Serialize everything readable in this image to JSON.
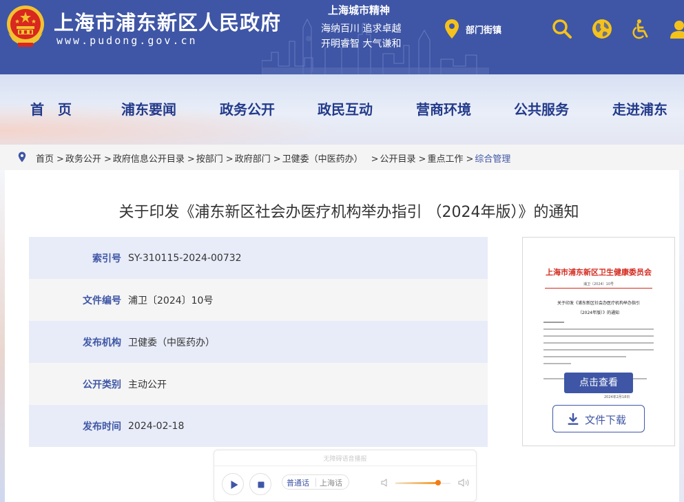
{
  "header": {
    "site_title": "上海市浦东新区人民政府",
    "site_url": "www.pudong.gov.cn",
    "spirit": {
      "title": "上海城市精神",
      "line1": "海纳百川   追求卓越",
      "line2": "开明睿智   大气谦和"
    },
    "department_link": "部门街镇",
    "icons": [
      "location-pin-icon",
      "search-icon",
      "globe-icon",
      "accessibility-icon",
      "user-icon"
    ]
  },
  "nav": {
    "items": [
      "首　页",
      "浦东要闻",
      "政务公开",
      "政民互动",
      "营商环境",
      "公共服务",
      "走进浦东"
    ]
  },
  "breadcrumb": {
    "items": [
      "首页",
      "政务公开",
      "政府信息公开目录",
      "按部门",
      "政府部门",
      "卫健委（中医药办）",
      "公开目录",
      "重点工作",
      "综合管理"
    ],
    "separator": ">"
  },
  "article": {
    "title": "关于印发《浦东新区社会办医疗机构举办指引 （2024年版）》的通知",
    "meta": [
      {
        "label": "索引号",
        "value": "SY-310115-2024-00732"
      },
      {
        "label": "文件编号",
        "value": "浦卫〔2024〕10号"
      },
      {
        "label": "发布机构",
        "value": "卫健委（中医药办）"
      },
      {
        "label": "公开类别",
        "value": "主动公开"
      },
      {
        "label": "发布时间",
        "value": "2024-02-18"
      }
    ]
  },
  "preview": {
    "org_header": "上海市浦东新区卫生健康委员会",
    "doc_number": "浦卫〔2024〕10号",
    "doc_heading_line1": "关于印发《浦东新区社会办医疗机构举办指引",
    "doc_heading_line2": "（2024年版）》的通知",
    "sign_date": "2024年2月18日",
    "view_button": "点击查看",
    "download_button": "文件下载"
  },
  "player": {
    "title": "无障碍语音播报",
    "lang_options": [
      "普通话",
      "上海话"
    ],
    "selected_lang": "普通话",
    "volume_level": 0.78
  },
  "colors": {
    "primary": "#3f56a6",
    "nav_text": "#233a8a",
    "accent_yellow": "#f5c21b",
    "seal_red": "#d42a1e",
    "volume_orange": "#f37c15"
  }
}
